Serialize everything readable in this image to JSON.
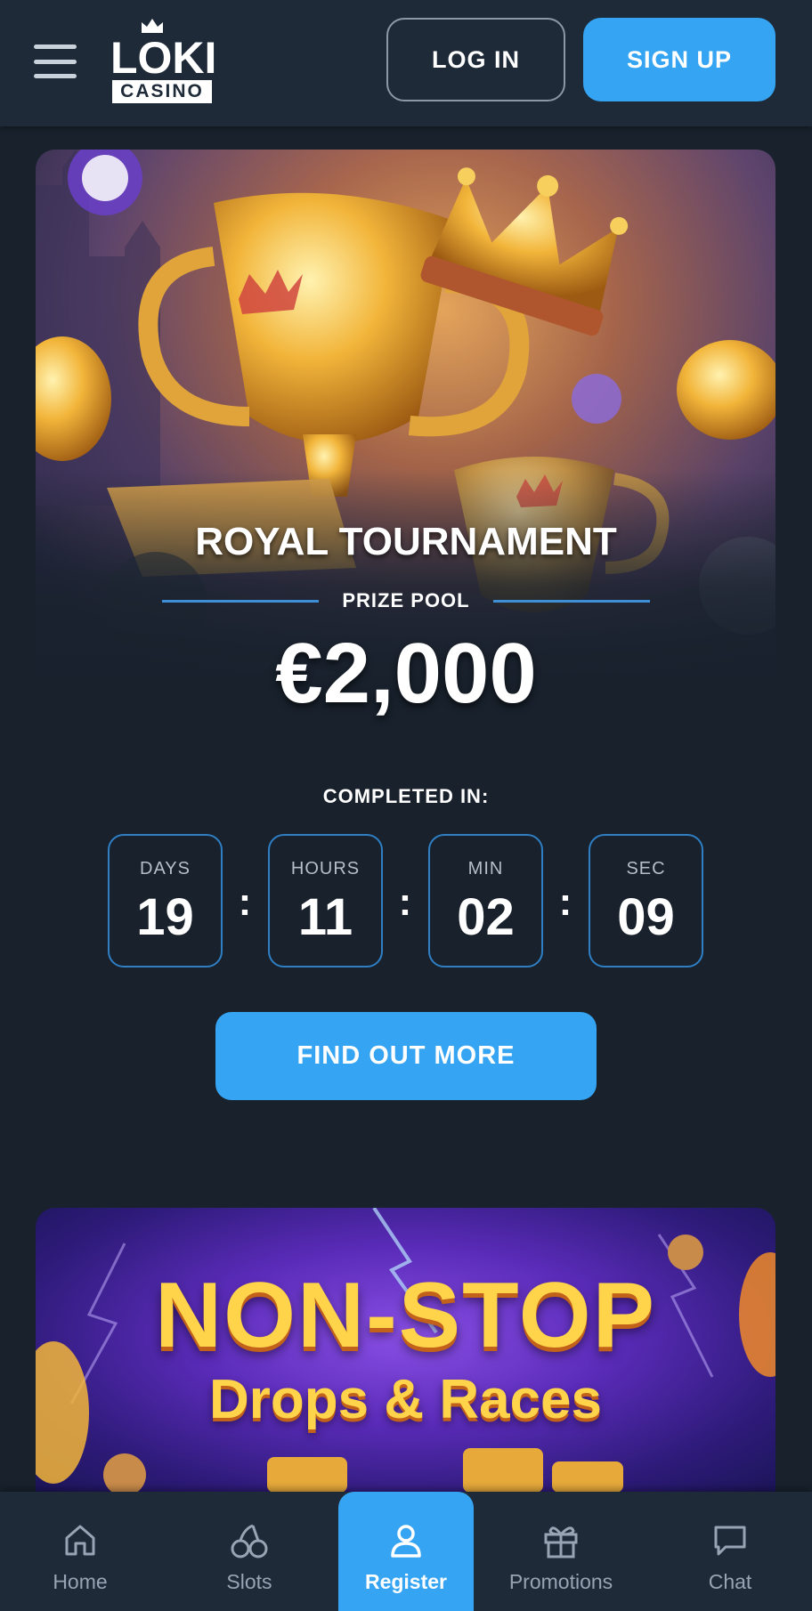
{
  "header": {
    "logo_main": "LOKI",
    "logo_sub": "CASINO",
    "login_label": "LOG IN",
    "signup_label": "SIGN UP"
  },
  "tournament": {
    "title": "ROYAL TOURNAMENT",
    "prize_label": "PRIZE POOL",
    "prize_amount": "€2,000",
    "completed_label": "COMPLETED IN:",
    "countdown": [
      {
        "label": "DAYS",
        "value": "19"
      },
      {
        "label": "HOURS",
        "value": "11"
      },
      {
        "label": "MIN",
        "value": "02"
      },
      {
        "label": "SEC",
        "value": "09"
      }
    ],
    "cta_label": "FIND OUT MORE"
  },
  "promo_banner": {
    "title": "NON-STOP",
    "subtitle": "Drops & Races"
  },
  "bottom_nav": {
    "items": [
      {
        "label": "Home",
        "icon": "home-icon"
      },
      {
        "label": "Slots",
        "icon": "cherries-icon"
      },
      {
        "label": "Register",
        "icon": "user-icon"
      },
      {
        "label": "Promotions",
        "icon": "gift-icon"
      },
      {
        "label": "Chat",
        "icon": "chat-icon"
      }
    ]
  },
  "colors": {
    "background": "#18212c",
    "header": "#1e2a38",
    "accent": "#35a4f2",
    "countdown_border": "#2f7fc4"
  }
}
